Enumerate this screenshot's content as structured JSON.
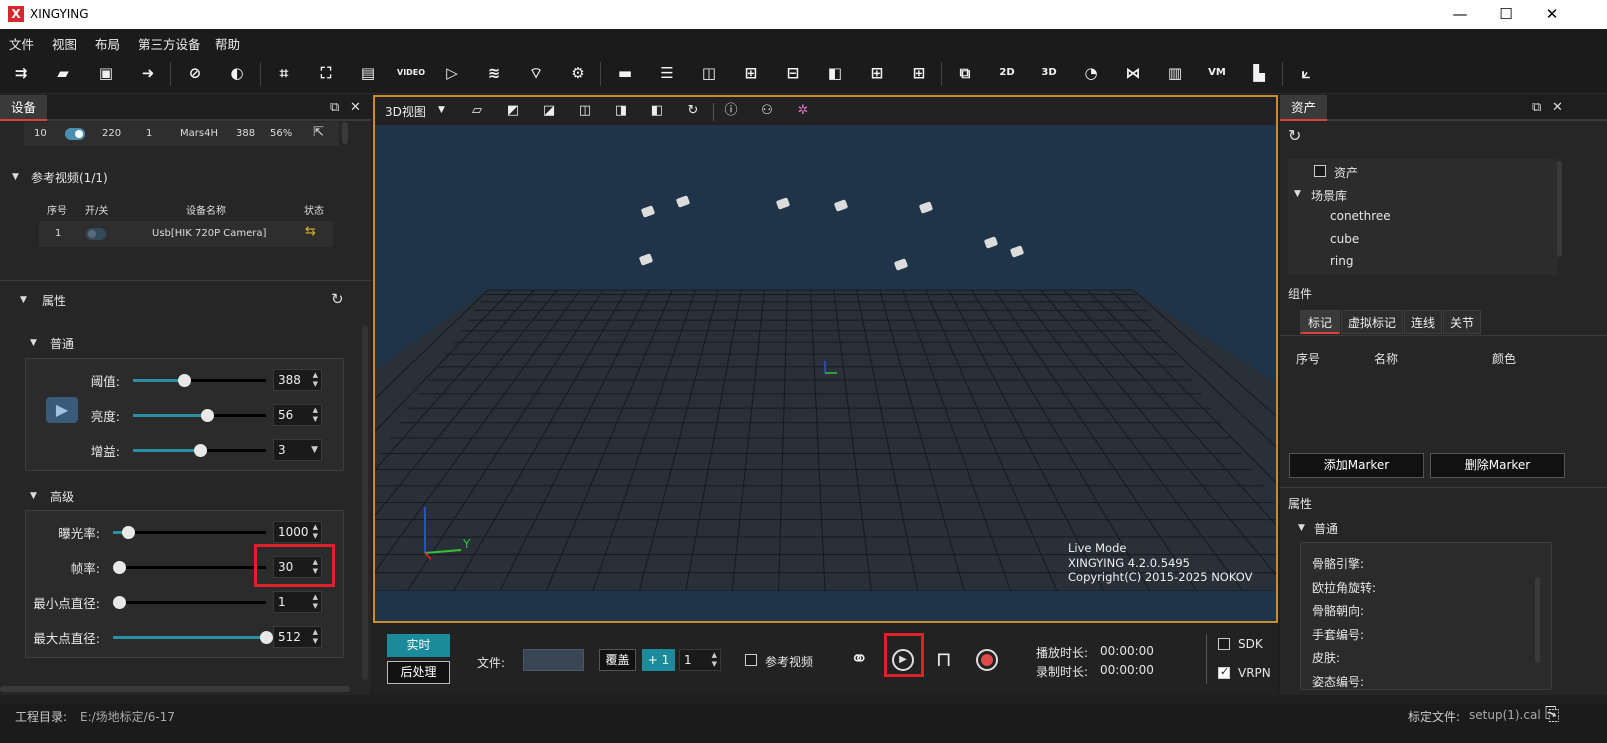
{
  "title": {
    "logo": "X",
    "app": "XINGYING",
    "minimize": "—",
    "maximize": "☐",
    "close": "✕"
  },
  "menu": [
    "文件",
    "视图",
    "布局",
    "第三方设备",
    "帮助"
  ],
  "toolbar_icons": [
    "open-icon",
    "ruler-icon",
    "save-icon",
    "save-as-icon",
    "hide-icon",
    "calibrate-icon",
    "crop-icon",
    "select-icon",
    "measure-icon",
    "video-icon",
    "play-icon",
    "layers-icon",
    "wifi-icon",
    "settings-icon",
    "monitor-icon",
    "layout-1-icon",
    "layout-2-icon",
    "layout-3-icon",
    "layout-4-icon",
    "layout-5-icon",
    "layout-6-icon",
    "layout-7-icon",
    "record-icon",
    "2d-icon",
    "3d-icon",
    "gauge-icon",
    "graph-icon",
    "chart-icon",
    "vm-icon",
    "document-icon",
    "axis-icon"
  ],
  "left": {
    "tab": "设备",
    "camera_row": {
      "id": "10",
      "num": "220",
      "n": "1",
      "model": "Mars4H",
      "thresh": "388",
      "pct": "56%"
    },
    "ref_video": {
      "title": "参考视频(1/1)",
      "headers": [
        "序号",
        "开/关",
        "设备名称",
        "状态"
      ],
      "row": {
        "idx": "1",
        "name": "Usb[HIK 720P Camera]"
      }
    },
    "props_title": "属性",
    "normal_title": "普通",
    "normal": [
      {
        "label": "阈值:",
        "value": "388",
        "level": 0.38
      },
      {
        "label": "亮度:",
        "value": "56",
        "level": 0.56
      },
      {
        "label": "增益:",
        "value": "3",
        "level": 0.5
      }
    ],
    "advanced_title": "高级",
    "advanced": [
      {
        "label": "曝光率:",
        "value": "1000",
        "level": 0.1
      },
      {
        "label": "帧率:",
        "value": "30",
        "level": 0.0
      },
      {
        "label": "最小点直径:",
        "value": "1",
        "level": 0.0
      },
      {
        "label": "最大点直径:",
        "value": "512",
        "level": 1.0
      }
    ]
  },
  "view": {
    "mode_label": "3D视图",
    "overlay": {
      "line1": "Live Mode",
      "line2": "XINGYING 4.2.0.5495",
      "line3": "Copyright(C) 2015-2025 NOKOV"
    },
    "axis_y": "Y"
  },
  "bottom": {
    "realtime": "实时",
    "post": "后处理",
    "file_label": "文件:",
    "cover": "覆盖",
    "plus1": "+ 1",
    "count": "1",
    "ref_video": "参考视频",
    "play_time_label": "播放时长:",
    "play_time": "00:00:00",
    "rec_time_label": "录制时长:",
    "rec_time": "00:00:00",
    "sdk": "SDK",
    "vrpn": "VRPN"
  },
  "right": {
    "tab": "资产",
    "assets": "资产",
    "scene_lib": "场景库",
    "scenes": [
      "conethree",
      "cube",
      "ring"
    ],
    "component": "组件",
    "subtabs": [
      "标记",
      "虚拟标记",
      "连线",
      "关节"
    ],
    "cols": [
      "序号",
      "名称",
      "颜色"
    ],
    "add_marker": "添加Marker",
    "del_marker": "删除Marker",
    "props": "属性",
    "normal": "普通",
    "fields": [
      "骨骼引擎:",
      "欧拉角旋转:",
      "骨骼朝向:",
      "手套编号:",
      "皮肤:",
      "姿态编号:"
    ]
  },
  "status": {
    "proj_label": "工程目录:",
    "proj_path": "E:/场地标定/6-17",
    "cal_label": "标定文件:",
    "cal_file": "setup(1).cal"
  }
}
